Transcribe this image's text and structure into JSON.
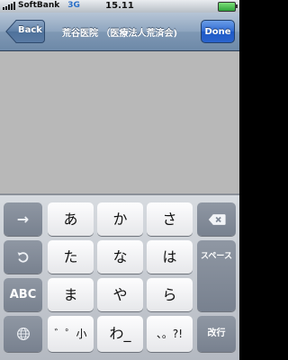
{
  "status_bar": {
    "carrier": "SoftBank",
    "network": "3G",
    "time": "15.11"
  },
  "nav": {
    "back_label": "Back",
    "title": "荒谷医院 （医療法人荒済会)",
    "done_label": "Done"
  },
  "keyboard": {
    "kana_row1": [
      "あ",
      "か",
      "さ"
    ],
    "kana_row2": [
      "た",
      "な",
      "は"
    ],
    "kana_row3": [
      "ま",
      "や",
      "ら"
    ],
    "kana_row4": [
      "゛゜小",
      "わ_",
      "、。?!"
    ],
    "left_keys": {
      "arrow": "→",
      "undo_icon": "undo-icon",
      "abc": "ABC",
      "globe_icon": "globe-icon"
    },
    "right_keys": {
      "delete_icon": "delete-icon",
      "space": "スペース",
      "return": "改行"
    }
  }
}
